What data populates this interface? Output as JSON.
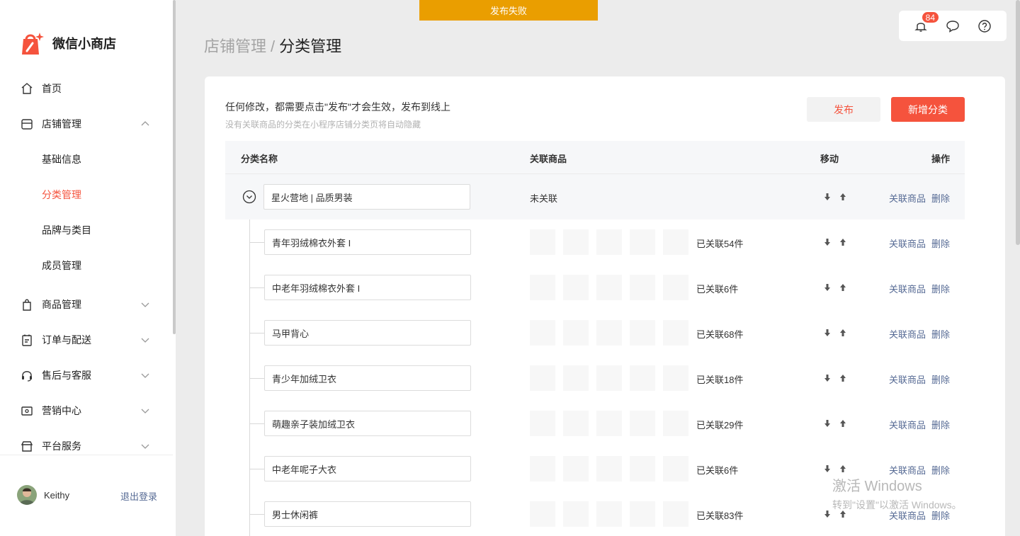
{
  "brand": {
    "name": "微信小商店",
    "accent": "#f5533d"
  },
  "banner": {
    "text": "发布失败",
    "color": "#ea9e00"
  },
  "notifications": {
    "count": "84"
  },
  "breadcrumb": {
    "parent": "店铺管理",
    "separator": "/",
    "current": "分类管理"
  },
  "nav": {
    "home": "首页",
    "store": "店铺管理",
    "store_sub": [
      "基础信息",
      "分类管理",
      "品牌与类目",
      "成员管理"
    ],
    "goods": "商品管理",
    "orders": "订单与配送",
    "aftersale": "售后与客服",
    "marketing": "营销中心",
    "platform": "平台服务"
  },
  "user": {
    "name": "Keithy",
    "logout": "退出登录"
  },
  "notice": {
    "line1": "任何修改，都需要点击\"发布\"才会生效，发布到线上",
    "line2": "没有关联商品的分类在小程序店铺分类页将自动隐藏"
  },
  "buttons": {
    "publish": "发布",
    "add_category": "新增分类"
  },
  "table": {
    "headers": {
      "name": "分类名称",
      "goods": "关联商品",
      "move": "移动",
      "ops": "操作"
    },
    "parent": {
      "name": "星火营地 | 品质男装",
      "linked": "未关联"
    },
    "children": [
      {
        "name": "青年羽绒棉衣外套 I",
        "count": "已关联54件"
      },
      {
        "name": "中老年羽绒棉衣外套 I",
        "count": "已关联6件"
      },
      {
        "name": "马甲背心",
        "count": "已关联68件"
      },
      {
        "name": "青少年加绒卫衣",
        "count": "已关联18件"
      },
      {
        "name": "萌趣亲子装加绒卫衣",
        "count": "已关联29件"
      },
      {
        "name": "中老年呢子大衣",
        "count": "已关联6件"
      },
      {
        "name": "男士休闲裤",
        "count": "已关联83件"
      }
    ],
    "op_link": "关联商品",
    "op_delete": "删除"
  },
  "watermark": {
    "line1": "激活 Windows",
    "line2": "转到\"设置\"以激活 Windows。"
  }
}
